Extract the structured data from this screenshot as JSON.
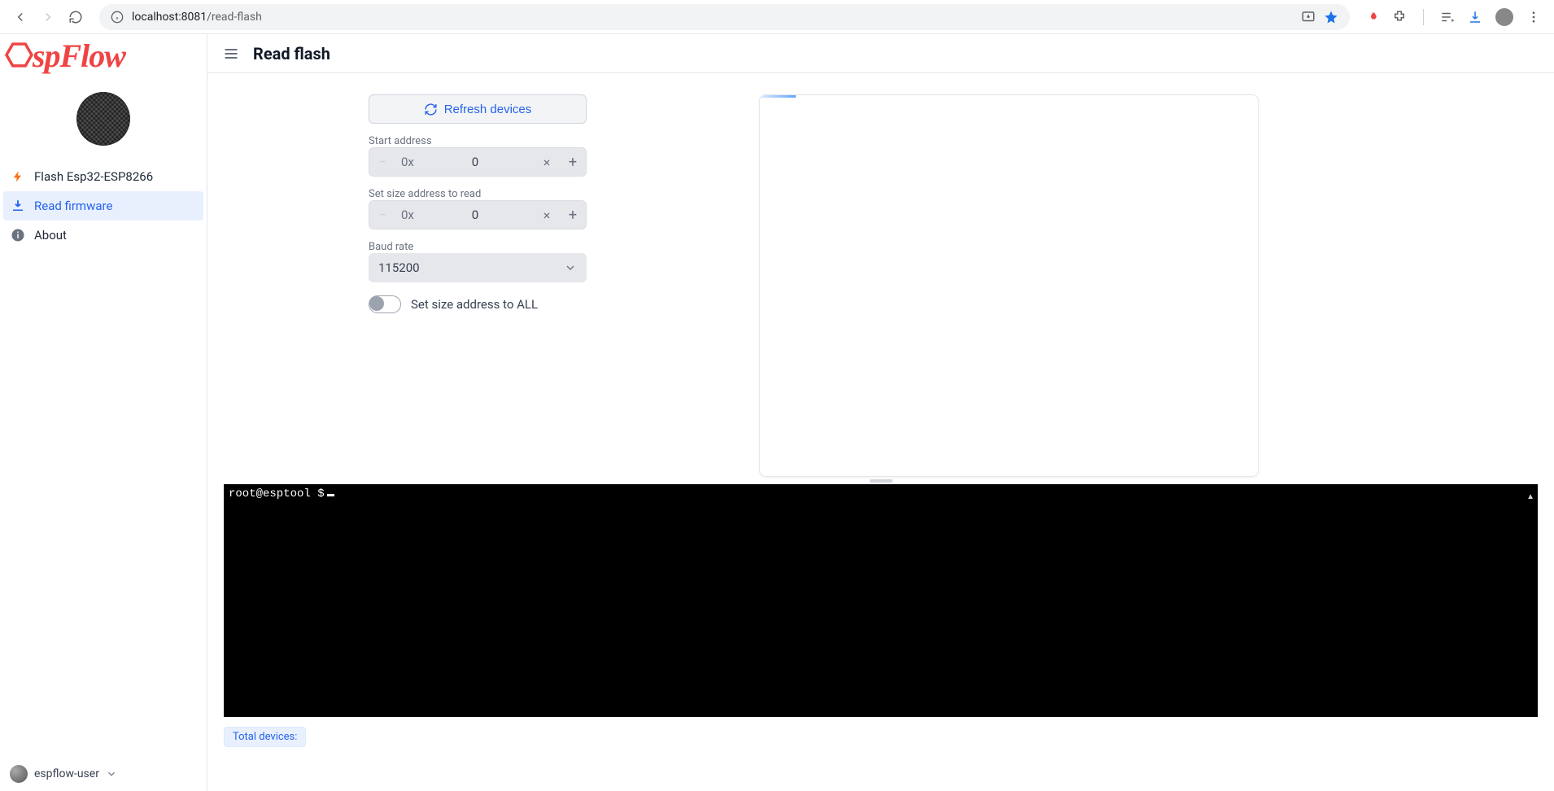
{
  "browser": {
    "url_host": "localhost:8081",
    "url_path": "/read-flash"
  },
  "sidebar": {
    "logo": "EspFlow",
    "items": [
      {
        "label": "Flash Esp32-ESP8266",
        "icon": "bolt"
      },
      {
        "label": "Read firmware",
        "icon": "download"
      },
      {
        "label": "About",
        "icon": "info"
      }
    ],
    "user": "espflow-user"
  },
  "header": {
    "title": "Read flash"
  },
  "form": {
    "refresh_label": "Refresh devices",
    "start_address": {
      "label": "Start address",
      "prefix": "0x",
      "value": "0"
    },
    "size_address": {
      "label": "Set size address to read",
      "prefix": "0x",
      "value": "0"
    },
    "baud_rate": {
      "label": "Baud rate",
      "value": "115200"
    },
    "size_all_toggle": {
      "label": "Set size address to ALL",
      "on": false
    }
  },
  "terminal": {
    "prompt": "root@esptool $"
  },
  "status": {
    "total_devices_label": "Total devices:"
  }
}
